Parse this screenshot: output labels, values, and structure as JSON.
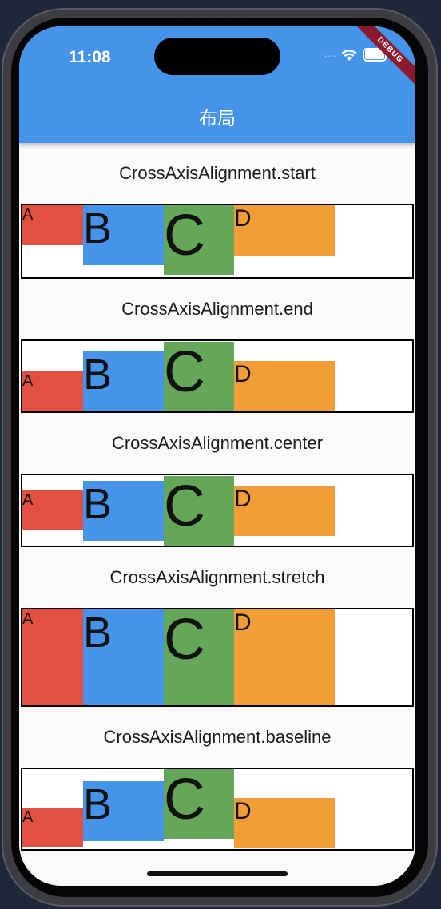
{
  "status_bar": {
    "time": "11:08"
  },
  "app_bar": {
    "title": "布局",
    "debug_banner": "DEBUG",
    "color": "#4594e9"
  },
  "colors": {
    "A": "#e25042",
    "B": "#4594e9",
    "C": "#65a758",
    "D": "#f29d38"
  },
  "sections": [
    {
      "label": "CrossAxisAlignment.start",
      "boxes": [
        "A",
        "B",
        "C",
        "D"
      ]
    },
    {
      "label": "CrossAxisAlignment.end",
      "boxes": [
        "A",
        "B",
        "C",
        "D"
      ]
    },
    {
      "label": "CrossAxisAlignment.center",
      "boxes": [
        "A",
        "B",
        "C",
        "D"
      ]
    },
    {
      "label": "CrossAxisAlignment.stretch",
      "boxes": [
        "A",
        "B",
        "C",
        "D"
      ]
    },
    {
      "label": "CrossAxisAlignment.baseline",
      "boxes": [
        "A",
        "B",
        "C",
        "D"
      ]
    }
  ]
}
